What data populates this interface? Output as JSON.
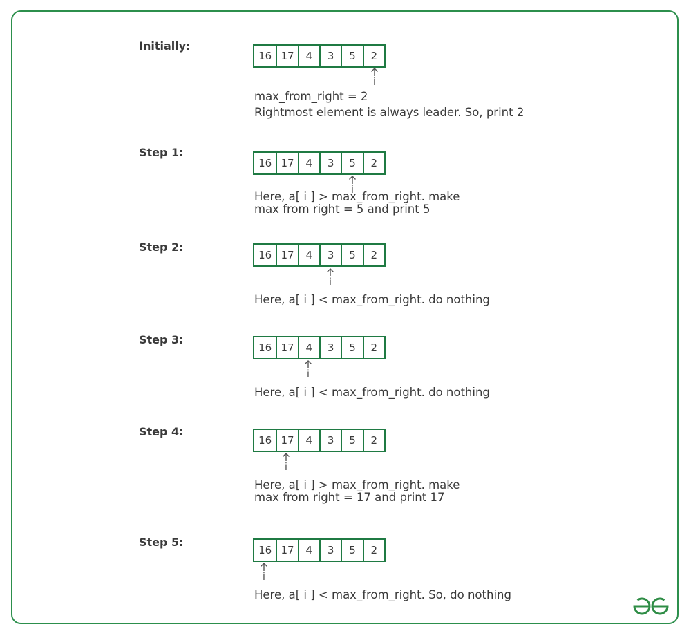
{
  "array": [
    "16",
    "17",
    "4",
    "3",
    "5",
    "2"
  ],
  "pointer_label": "i",
  "steps": [
    {
      "label": "Initially:",
      "pointer_index": 5,
      "lines": [
        "max_from_right = 2",
        "Rightmost element is always leader. So, print 2"
      ]
    },
    {
      "label": "Step 1:",
      "pointer_index": 4,
      "lines": [
        "Here, a[ i ] > max_from_right. make",
        "max from right = 5 and print 5"
      ]
    },
    {
      "label": "Step 2:",
      "pointer_index": 3,
      "lines": [
        "Here, a[ i ] < max_from_right. do nothing"
      ]
    },
    {
      "label": "Step 3:",
      "pointer_index": 2,
      "lines": [
        "Here, a[ i ] < max_from_right. do nothing"
      ]
    },
    {
      "label": "Step 4:",
      "pointer_index": 1,
      "lines": [
        "Here, a[ i ] > max_from_right. make",
        "max from right = 17 and print 17"
      ]
    },
    {
      "label": "Step 5:",
      "pointer_index": 0,
      "lines": [
        "Here, a[ i ] < max_from_right. So, do nothing"
      ]
    }
  ],
  "colors": {
    "border": "#2c8f4c",
    "cell_border": "#1f7a43",
    "text": "#3a3a3a",
    "logo": "#2f8d46"
  },
  "logo_icon": "geeksforgeeks-logo-icon"
}
